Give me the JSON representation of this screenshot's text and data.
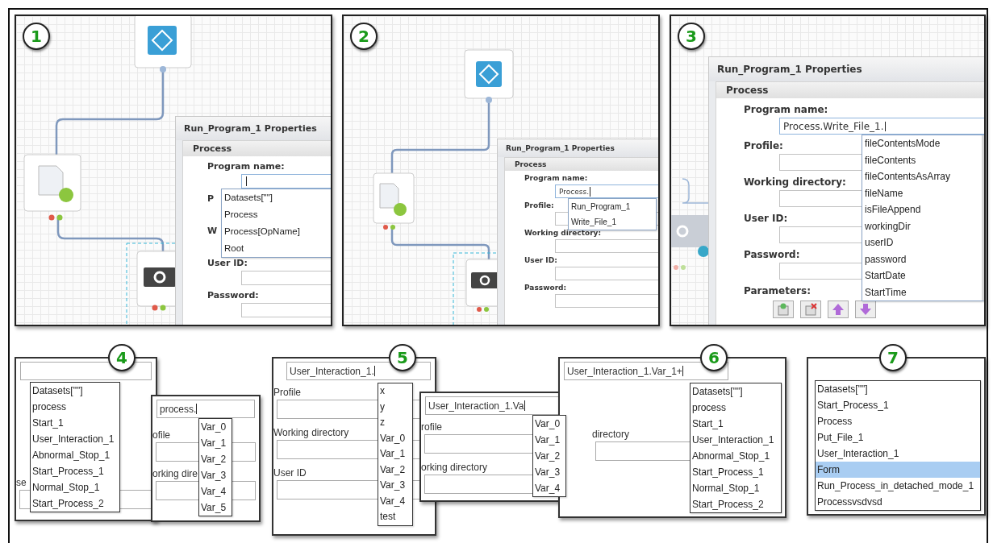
{
  "top_panels": [
    {
      "number": "1",
      "dialog": {
        "title": "Run_Program_1 Properties",
        "section": "Process",
        "fields": [
          {
            "label": "Program name:",
            "focused": true
          },
          {
            "label": "P"
          },
          {
            "label": "W"
          },
          {
            "label": "User ID:",
            "focused": false
          },
          {
            "label": "Password:",
            "focused": false
          }
        ],
        "suggestions": [
          {
            "label": "Datasets[\"\"]",
            "selected": false
          },
          {
            "label": "Process",
            "selected": false
          },
          {
            "label": "Process[OpName]",
            "selected": false
          },
          {
            "label": "Root",
            "selected": false
          }
        ]
      }
    },
    {
      "number": "2",
      "dialog": {
        "title": "Run_Program_1 Properties",
        "section": "Process",
        "fields": [
          {
            "label": "Program name:",
            "value": "Process.",
            "focused": true
          },
          {
            "label": "Profile:",
            "focused": false
          },
          {
            "label": "Working directory:",
            "focused": false
          },
          {
            "label": "User ID:",
            "focused": false
          },
          {
            "label": "Password:",
            "focused": false
          }
        ],
        "suggestions": [
          {
            "label": "Run_Program_1",
            "selected": false
          },
          {
            "label": "Write_File_1",
            "selected": false
          }
        ]
      }
    },
    {
      "number": "3",
      "dialog": {
        "title": "Run_Program_1 Properties",
        "section": "Process",
        "fields": [
          {
            "label": "Program name:",
            "value": "Process.Write_File_1.",
            "focused": true
          },
          {
            "label": "Profile:",
            "focused": false
          },
          {
            "label": "Working directory:",
            "focused": false
          },
          {
            "label": "User ID:",
            "focused": false
          },
          {
            "label": "Password:",
            "focused": false
          }
        ],
        "parameters_label": "Parameters:",
        "toolbar": [
          {
            "kind": "add"
          },
          {
            "kind": "delete"
          },
          {
            "kind": "up"
          },
          {
            "kind": "down"
          }
        ],
        "suggestions": [
          {
            "label": "fileContentsMode",
            "selected": false
          },
          {
            "label": "fileContents",
            "selected": false
          },
          {
            "label": "fileContentsAsArray",
            "selected": false
          },
          {
            "label": "fileName",
            "selected": false
          },
          {
            "label": "isFileAppend",
            "selected": false
          },
          {
            "label": "workingDir",
            "selected": false
          },
          {
            "label": "userID",
            "selected": false
          },
          {
            "label": "password",
            "selected": false
          },
          {
            "label": "StartDate",
            "selected": false
          },
          {
            "label": "StartTime",
            "selected": false
          }
        ]
      }
    }
  ],
  "bottom_panels": [
    {
      "number": "4",
      "input_field": true,
      "labels": [
        "se"
      ],
      "suggestions": [
        {
          "label": "Datasets[\"\"]",
          "selected": false
        },
        {
          "label": "process",
          "selected": false
        },
        {
          "label": "Start_1",
          "selected": false
        },
        {
          "label": "User_Interaction_1",
          "selected": false
        },
        {
          "label": "Abnormal_Stop_1",
          "selected": false
        },
        {
          "label": "Start_Process_1",
          "selected": false
        },
        {
          "label": "Normal_Stop_1",
          "selected": false
        },
        {
          "label": "Start_Process_2",
          "selected": false
        }
      ]
    },
    {
      "input_field": true,
      "input": {
        "value": "process."
      },
      "labels": [
        "ofile",
        "orking dire"
      ],
      "suggestions": [
        {
          "label": "Var_0",
          "selected": false
        },
        {
          "label": "Var_1",
          "selected": false
        },
        {
          "label": "Var_2",
          "selected": false
        },
        {
          "label": "Var_3",
          "selected": false
        },
        {
          "label": "Var_4",
          "selected": false
        },
        {
          "label": "Var_5",
          "selected": false
        }
      ]
    },
    {
      "number": "5",
      "input_field": true,
      "input": {
        "value": "User_Interaction_1."
      },
      "labels": [
        "Profile",
        "Working directory",
        "User ID"
      ],
      "suggestions": [
        {
          "label": "x",
          "selected": false
        },
        {
          "label": "y",
          "selected": false
        },
        {
          "label": "z",
          "selected": false
        },
        {
          "label": "Var_0",
          "selected": false
        },
        {
          "label": "Var_1",
          "selected": false
        },
        {
          "label": "Var_2",
          "selected": false
        },
        {
          "label": "Var_3",
          "selected": false
        },
        {
          "label": "Var_4",
          "selected": false
        },
        {
          "label": "test",
          "selected": false
        }
      ]
    },
    {
      "input_field": true,
      "input": {
        "value": "User_Interaction_1.Va"
      },
      "labels": [
        "rofile",
        "orking directory"
      ],
      "suggestions": [
        {
          "label": "Var_0",
          "selected": false
        },
        {
          "label": "Var_1",
          "selected": false
        },
        {
          "label": "Var_2",
          "selected": false
        },
        {
          "label": "Var_3",
          "selected": false
        },
        {
          "label": "Var_4",
          "selected": false
        }
      ]
    },
    {
      "number": "6",
      "input_field": true,
      "input": {
        "value": "User_Interaction_1.Var_1+"
      },
      "labels": [
        "directory"
      ],
      "suggestions": [
        {
          "label": "Datasets[\"\"]",
          "selected": false
        },
        {
          "label": "process",
          "selected": false
        },
        {
          "label": "Start_1",
          "selected": false
        },
        {
          "label": "User_Interaction_1",
          "selected": false
        },
        {
          "label": "Abnormal_Stop_1",
          "selected": false
        },
        {
          "label": "Start_Process_1",
          "selected": false
        },
        {
          "label": "Normal_Stop_1",
          "selected": false
        },
        {
          "label": "Start_Process_2",
          "selected": false
        }
      ]
    },
    {
      "number": "7",
      "input_field": false,
      "suggestions": [
        {
          "label": "Datasets[\"\"]",
          "selected": false
        },
        {
          "label": "Start_Process_1",
          "selected": false
        },
        {
          "label": "Process",
          "selected": false
        },
        {
          "label": "Put_File_1",
          "selected": false
        },
        {
          "label": "User_Interaction_1",
          "selected": false
        },
        {
          "label": "Form",
          "selected": true
        },
        {
          "label": "Run_Process_in_detached_mode_1",
          "selected": false
        },
        {
          "label": "Processvsdvsd",
          "selected": false
        }
      ]
    }
  ]
}
